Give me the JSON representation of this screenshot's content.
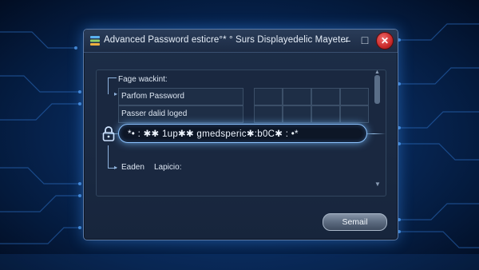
{
  "window": {
    "title": "Advanced Password esticre°* ° Surs Displayedelic Mayeter",
    "minimize_label": "–",
    "maximize_label": "□",
    "close_label": "✕"
  },
  "form": {
    "heading": "Fage wackint:",
    "rows": [
      "Parfom Password",
      "Passer dalid loged"
    ],
    "password_value": "*• : ✱✱ 1up✱✱ gmedsperic✱:b0C✱ : •*",
    "footer_label": "Eaden",
    "footer_value": "Lapicio:"
  },
  "submit_label": "Semail",
  "colors": {
    "background": "#082a5c",
    "window": "#17253c",
    "accent_glow": "#8cc3ff",
    "close_button": "#c92b2b"
  },
  "icons": [
    "app-layers-icon",
    "minimize-icon",
    "maximize-icon",
    "close-icon",
    "lock-icon",
    "scroll-up-icon",
    "scroll-down-icon"
  ]
}
